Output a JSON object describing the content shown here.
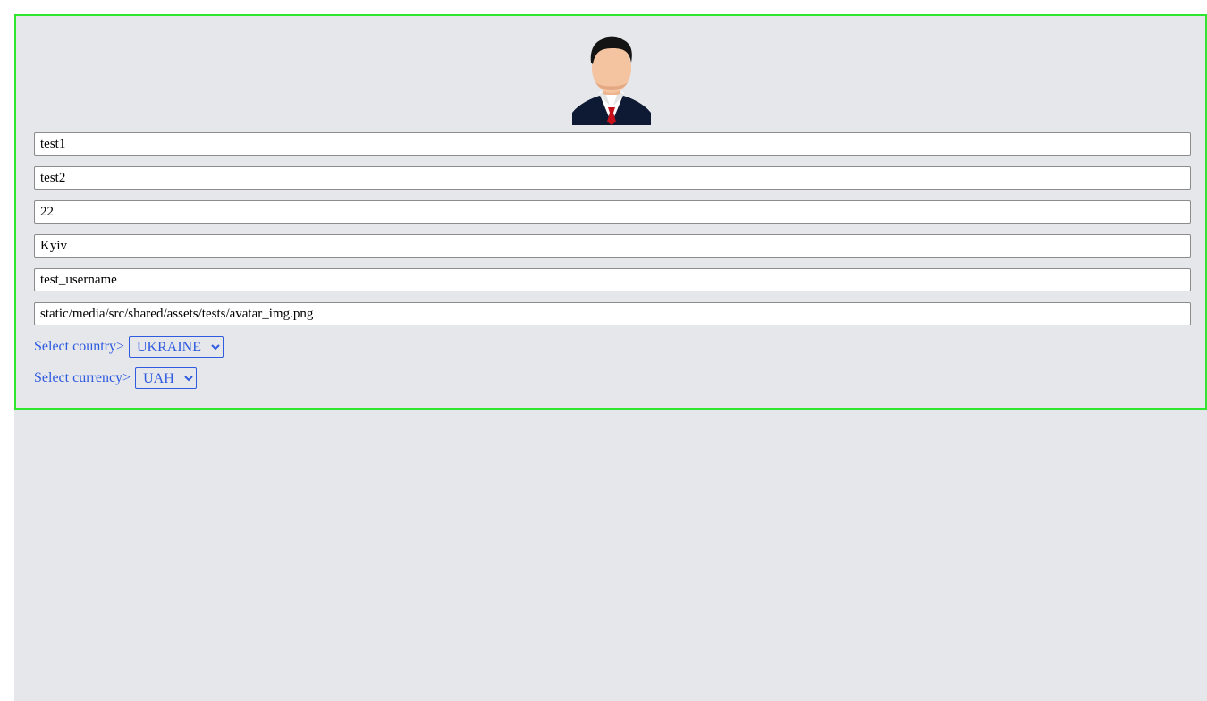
{
  "avatar": {
    "icon": "businessman-avatar-icon"
  },
  "fields": [
    {
      "name": "firstname-input",
      "value": "test1"
    },
    {
      "name": "lastname-input",
      "value": "test2"
    },
    {
      "name": "age-input",
      "value": "22"
    },
    {
      "name": "city-input",
      "value": "Kyiv"
    },
    {
      "name": "username-input",
      "value": "test_username"
    },
    {
      "name": "avatar-url-input",
      "value": "static/media/src/shared/assets/tests/avatar_img.png"
    }
  ],
  "country": {
    "label": "Select country>",
    "selected": "UKRAINE"
  },
  "currency": {
    "label": "Select currency>",
    "selected": "UAH"
  },
  "colors": {
    "accent": "#2f5be0",
    "card_border": "#2ee62e",
    "background": "#e6e7ea"
  }
}
